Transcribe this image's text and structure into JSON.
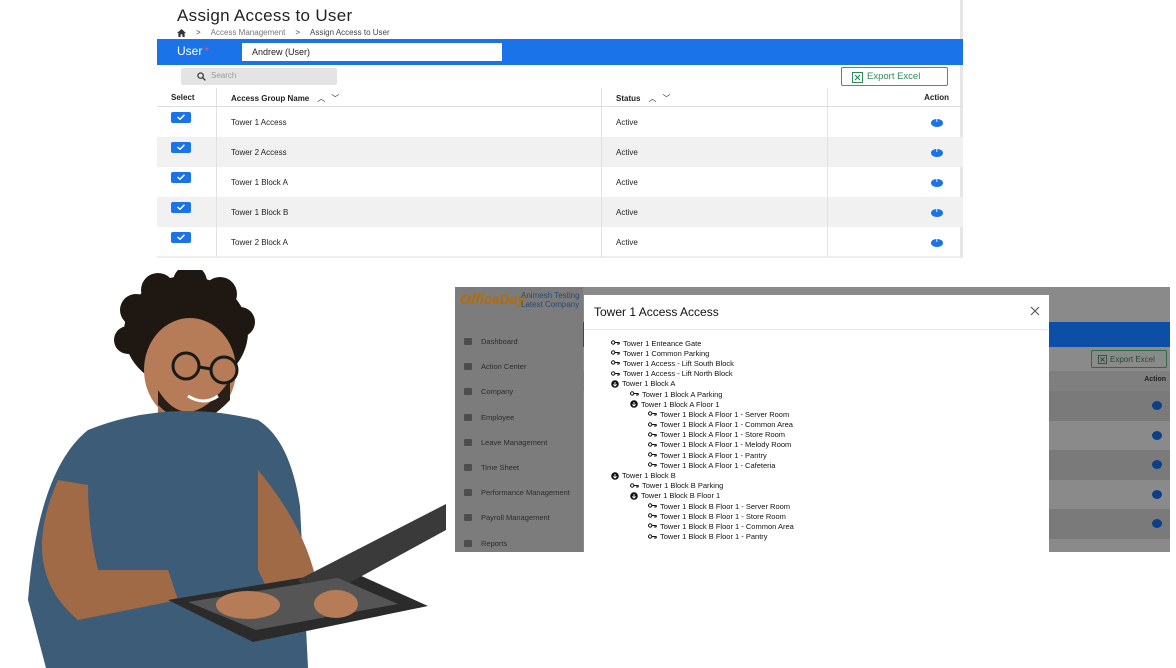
{
  "access_page": {
    "title": "Assign Access to User",
    "breadcrumb": [
      "Access Management",
      "Assign Access to User"
    ],
    "user_label": "User",
    "required_mark": "*",
    "user_value": "Andrew (User)",
    "search_placeholder": "Search",
    "export_label": "Export Excel",
    "columns": {
      "select": "Select",
      "name": "Access Group Name",
      "status": "Status",
      "action": "Action"
    },
    "rows": [
      {
        "name": "Tower 1 Access",
        "status": "Active"
      },
      {
        "name": "Tower 2 Access",
        "status": "Active"
      },
      {
        "name": "Tower 1 Block A",
        "status": "Active"
      },
      {
        "name": "Tower 1 Block B",
        "status": "Active"
      },
      {
        "name": "Tower 2 Block A",
        "status": "Active"
      }
    ],
    "accent_color": "#1a73e8"
  },
  "app": {
    "logo_text": "OfficeDay",
    "org_line1": "Animesh Testing",
    "org_line2": "Latest Company",
    "sidebar": [
      {
        "label": "Dashboard",
        "icon": "dashboard-icon"
      },
      {
        "label": "Action Center",
        "icon": "users-icon"
      },
      {
        "label": "Company",
        "icon": "building-icon"
      },
      {
        "label": "Employee",
        "icon": "users-icon"
      },
      {
        "label": "Leave Management",
        "icon": "users-icon"
      },
      {
        "label": "Time Sheet",
        "icon": "calendar-icon"
      },
      {
        "label": "Performance Management",
        "icon": "chart-icon"
      },
      {
        "label": "Payroll Management",
        "icon": "money-icon"
      },
      {
        "label": "Reports",
        "icon": "bar-chart-icon"
      }
    ],
    "export_label": "Export Excel",
    "action_label": "Action"
  },
  "modal": {
    "title": "Tower 1 Access Access",
    "tree": [
      {
        "label": "Tower 1 Enteance Gate",
        "type": "key"
      },
      {
        "label": "Tower 1 Common Parking",
        "type": "key"
      },
      {
        "label": "Tower 1 Access - Lift South Block",
        "type": "key"
      },
      {
        "label": "Tower 1 Access - Lift North Block",
        "type": "key"
      },
      {
        "label": "Tower 1 Block A",
        "type": "group"
      },
      {
        "label": "Tower 1 Block A Parking",
        "type": "key"
      },
      {
        "label": "Tower 1 Block A Floor 1",
        "type": "group"
      },
      {
        "label": "Tower 1 Block A Floor 1 - Server Room",
        "type": "key"
      },
      {
        "label": "Tower 1 Block A Floor 1 - Common Area",
        "type": "key"
      },
      {
        "label": "Tower 1 Block A Floor 1 - Store Room",
        "type": "key"
      },
      {
        "label": "Tower 1 Block A Floor 1 - Melody Room",
        "type": "key"
      },
      {
        "label": "Tower 1 Block A Floor 1 - Pantry",
        "type": "key"
      },
      {
        "label": "Tower 1 Block A Floor 1 - Cafeteria",
        "type": "key"
      },
      {
        "label": "Tower 1 Block B",
        "type": "group"
      },
      {
        "label": "Tower 1 Block B Parking",
        "type": "key"
      },
      {
        "label": "Tower 1 Block B Floor 1",
        "type": "group"
      },
      {
        "label": "Tower 1 Block B Floor 1 - Server Room",
        "type": "key"
      },
      {
        "label": "Tower 1 Block B Floor 1 - Store Room",
        "type": "key"
      },
      {
        "label": "Tower 1 Block B Floor 1 - Common Area",
        "type": "key"
      },
      {
        "label": "Tower 1 Block B Floor 1 - Pantry",
        "type": "key"
      }
    ]
  }
}
